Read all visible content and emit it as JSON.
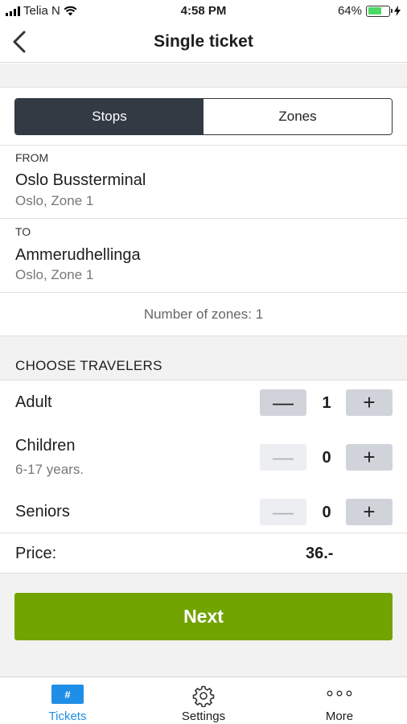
{
  "status_bar": {
    "carrier": "Telia N",
    "time": "4:58 PM",
    "battery_percent": "64%",
    "battery_level": 0.64,
    "battery_color": "#4cd964",
    "icons": [
      "signal-icon",
      "wifi-icon",
      "battery-icon",
      "charging-bolt-icon"
    ]
  },
  "nav": {
    "title": "Single ticket",
    "back_icon": "chevron-left-icon"
  },
  "segmented": {
    "options": [
      "Stops",
      "Zones"
    ],
    "selected": "Stops"
  },
  "from": {
    "label": "FROM",
    "name": "Oslo Bussterminal",
    "zone": "Oslo, Zone 1"
  },
  "to": {
    "label": "TO",
    "name": "Ammerudhellinga",
    "zone": "Oslo, Zone 1"
  },
  "zones_text": "Number of zones: 1",
  "travelers": {
    "title": "CHOOSE TRAVELERS",
    "items": [
      {
        "label": "Adult",
        "sublabel": "",
        "count": "1",
        "minus": "—",
        "plus": "+"
      },
      {
        "label": "Children",
        "sublabel": "6-17 years.",
        "count": "0",
        "minus": "—",
        "plus": "+"
      },
      {
        "label": "Seniors",
        "sublabel": "",
        "count": "0",
        "minus": "—",
        "plus": "+"
      }
    ]
  },
  "price": {
    "label": "Price:",
    "value": "36.-"
  },
  "next_button": "Next",
  "colors": {
    "accent_green": "#72a400",
    "segment_dark": "#323a43",
    "tab_active": "#1f8ee6"
  },
  "tabs": [
    {
      "label": "Tickets",
      "icon": "ticket-icon",
      "glyph": "#",
      "active": true
    },
    {
      "label": "Settings",
      "icon": "gear-icon",
      "active": false
    },
    {
      "label": "More",
      "icon": "more-dots-icon",
      "active": false
    }
  ]
}
